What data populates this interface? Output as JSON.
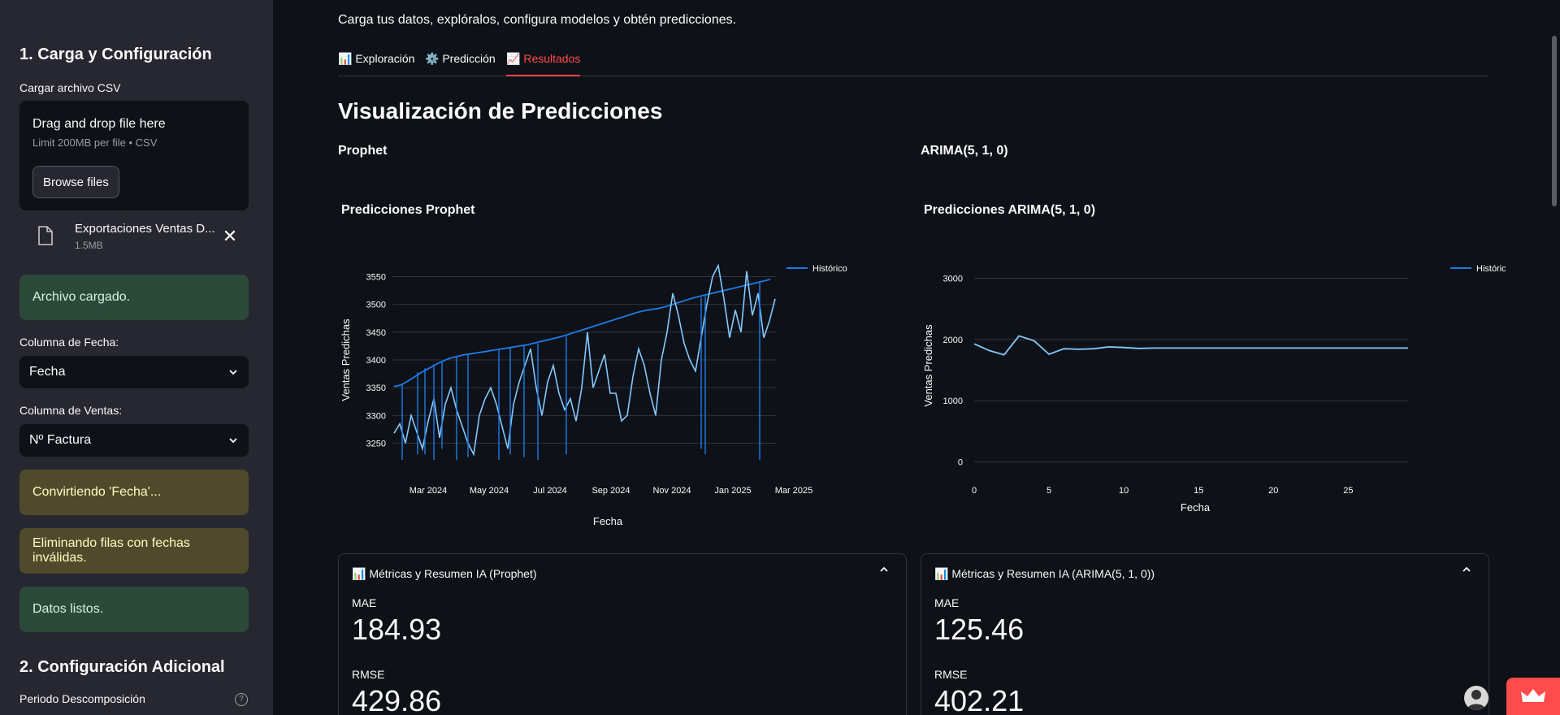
{
  "sidebar": {
    "section1_title": "1. Carga y Configuración",
    "upload_label": "Cargar archivo CSV",
    "dropzone_text": "Drag and drop file here",
    "dropzone_limit": "Limit 200MB per file • CSV",
    "browse_label": "Browse files",
    "file_name": "Exportaciones Ventas D...",
    "file_size": "1.5MB",
    "alerts": [
      "Archivo cargado.",
      "Convirtiendo 'Fecha'...",
      "Eliminando filas con fechas inválidas.",
      "Datos listos."
    ],
    "date_col_label": "Columna de Fecha:",
    "date_col_value": "Fecha",
    "sales_col_label": "Columna de Ventas:",
    "sales_col_value": "Nº Factura",
    "section2_title": "2. Configuración Adicional",
    "period_label": "Periodo Descomposición"
  },
  "main": {
    "subtitle": "Carga tus datos, explóralos, configura modelos y obtén predicciones.",
    "tabs": [
      {
        "icon": "📊",
        "label": "Exploración"
      },
      {
        "icon": "⚙️",
        "label": "Predicción"
      },
      {
        "icon": "📈",
        "label": "Resultados"
      }
    ],
    "active_tab": "Resultados",
    "page_title": "Visualización de Predicciones",
    "col_left_title": "Prophet",
    "col_right_title": "ARIMA(5, 1, 0)",
    "cards": [
      {
        "title": "Métricas y Resumen IA (Prophet)",
        "mae_label": "MAE",
        "mae": "184.93",
        "rmse_label": "RMSE",
        "rmse": "429.86"
      },
      {
        "title": "Métricas y Resumen IA (ARIMA(5, 1, 0))",
        "mae_label": "MAE",
        "mae": "125.46",
        "rmse_label": "RMSE",
        "rmse": "402.21"
      }
    ]
  },
  "colors": {
    "accent": "#ff4b4b",
    "series_dark": "#1c7ce8",
    "series_light": "#83c9ff",
    "success_bg": "#2b4a3a",
    "warning_bg": "#504a2c"
  },
  "chart_data": [
    {
      "type": "line",
      "title": "Predicciones Prophet",
      "xlabel": "Fecha",
      "ylabel": "Ventas Predichas",
      "x_tick_labels": [
        "Mar 2024",
        "May 2024",
        "Jul 2024",
        "Sep 2024",
        "Nov 2024",
        "Jan 2025",
        "Mar 2025"
      ],
      "y_ticks": [
        3250,
        3300,
        3350,
        3400,
        3450,
        3500,
        3550
      ],
      "ylim": [
        3220,
        3580
      ],
      "legend": [
        "Histórico"
      ],
      "series": [
        {
          "name": "Histórico",
          "role": "trend",
          "values": [
            3352,
            3355,
            3362,
            3370,
            3378,
            3385,
            3392,
            3398,
            3403,
            3406,
            3409,
            3411,
            3413,
            3415,
            3417,
            3419,
            3421,
            3423,
            3425,
            3427,
            3430,
            3433,
            3436,
            3439,
            3442,
            3446,
            3450,
            3454,
            3458,
            3462,
            3466,
            3470,
            3474,
            3478,
            3482,
            3486,
            3489,
            3491,
            3493,
            3496,
            3500,
            3504,
            3508,
            3512,
            3515,
            3518,
            3521,
            3524,
            3527,
            3530,
            3533,
            3536,
            3539,
            3542,
            3545
          ]
        },
        {
          "role": "actual",
          "values": [
            3268,
            3285,
            3250,
            3300,
            3270,
            3240,
            3290,
            3330,
            3260,
            3320,
            3350,
            3310,
            3280,
            3250,
            3230,
            3300,
            3330,
            3350,
            3320,
            3280,
            3240,
            3320,
            3360,
            3390,
            3420,
            3350,
            3300,
            3360,
            3390,
            3340,
            3310,
            3330,
            3290,
            3350,
            3450,
            3350,
            3380,
            3410,
            3340,
            3340,
            3290,
            3300,
            3370,
            3420,
            3390,
            3340,
            3300,
            3400,
            3450,
            3520,
            3480,
            3430,
            3400,
            3380,
            3440,
            3500,
            3550,
            3570,
            3510,
            3440,
            3490,
            3450,
            3560,
            3480,
            3520,
            3440,
            3470,
            3510
          ]
        },
        {
          "role": "spikes",
          "values": [
            3220,
            3230,
            3230,
            3220,
            3240,
            3220,
            3225,
            3220,
            3230,
            3225,
            3220,
            3230,
            3240,
            3230,
            3220
          ]
        }
      ]
    },
    {
      "type": "line",
      "title": "Predicciones ARIMA(5, 1, 0)",
      "xlabel": "Fecha",
      "ylabel": "Ventas Predichas",
      "x_ticks": [
        0,
        5,
        10,
        15,
        20,
        25
      ],
      "y_ticks": [
        0,
        1000,
        2000,
        3000
      ],
      "xlim": [
        0,
        29
      ],
      "ylim": [
        -100,
        3300
      ],
      "legend": [
        "Histórico"
      ],
      "series": [
        {
          "name": "Histórico",
          "x": [
            0,
            1,
            2,
            3,
            4,
            5,
            6,
            7,
            8,
            9,
            10,
            11,
            12,
            13,
            14,
            15,
            16,
            17,
            18,
            19,
            20,
            21,
            22,
            23,
            24,
            25,
            26,
            27,
            28,
            29
          ],
          "values": [
            1930,
            1820,
            1750,
            2060,
            1980,
            1760,
            1850,
            1840,
            1850,
            1880,
            1870,
            1855,
            1860,
            1860,
            1860,
            1860,
            1860,
            1860,
            1860,
            1860,
            1860,
            1860,
            1860,
            1860,
            1860,
            1860,
            1860,
            1860,
            1860,
            1860
          ]
        }
      ]
    }
  ]
}
